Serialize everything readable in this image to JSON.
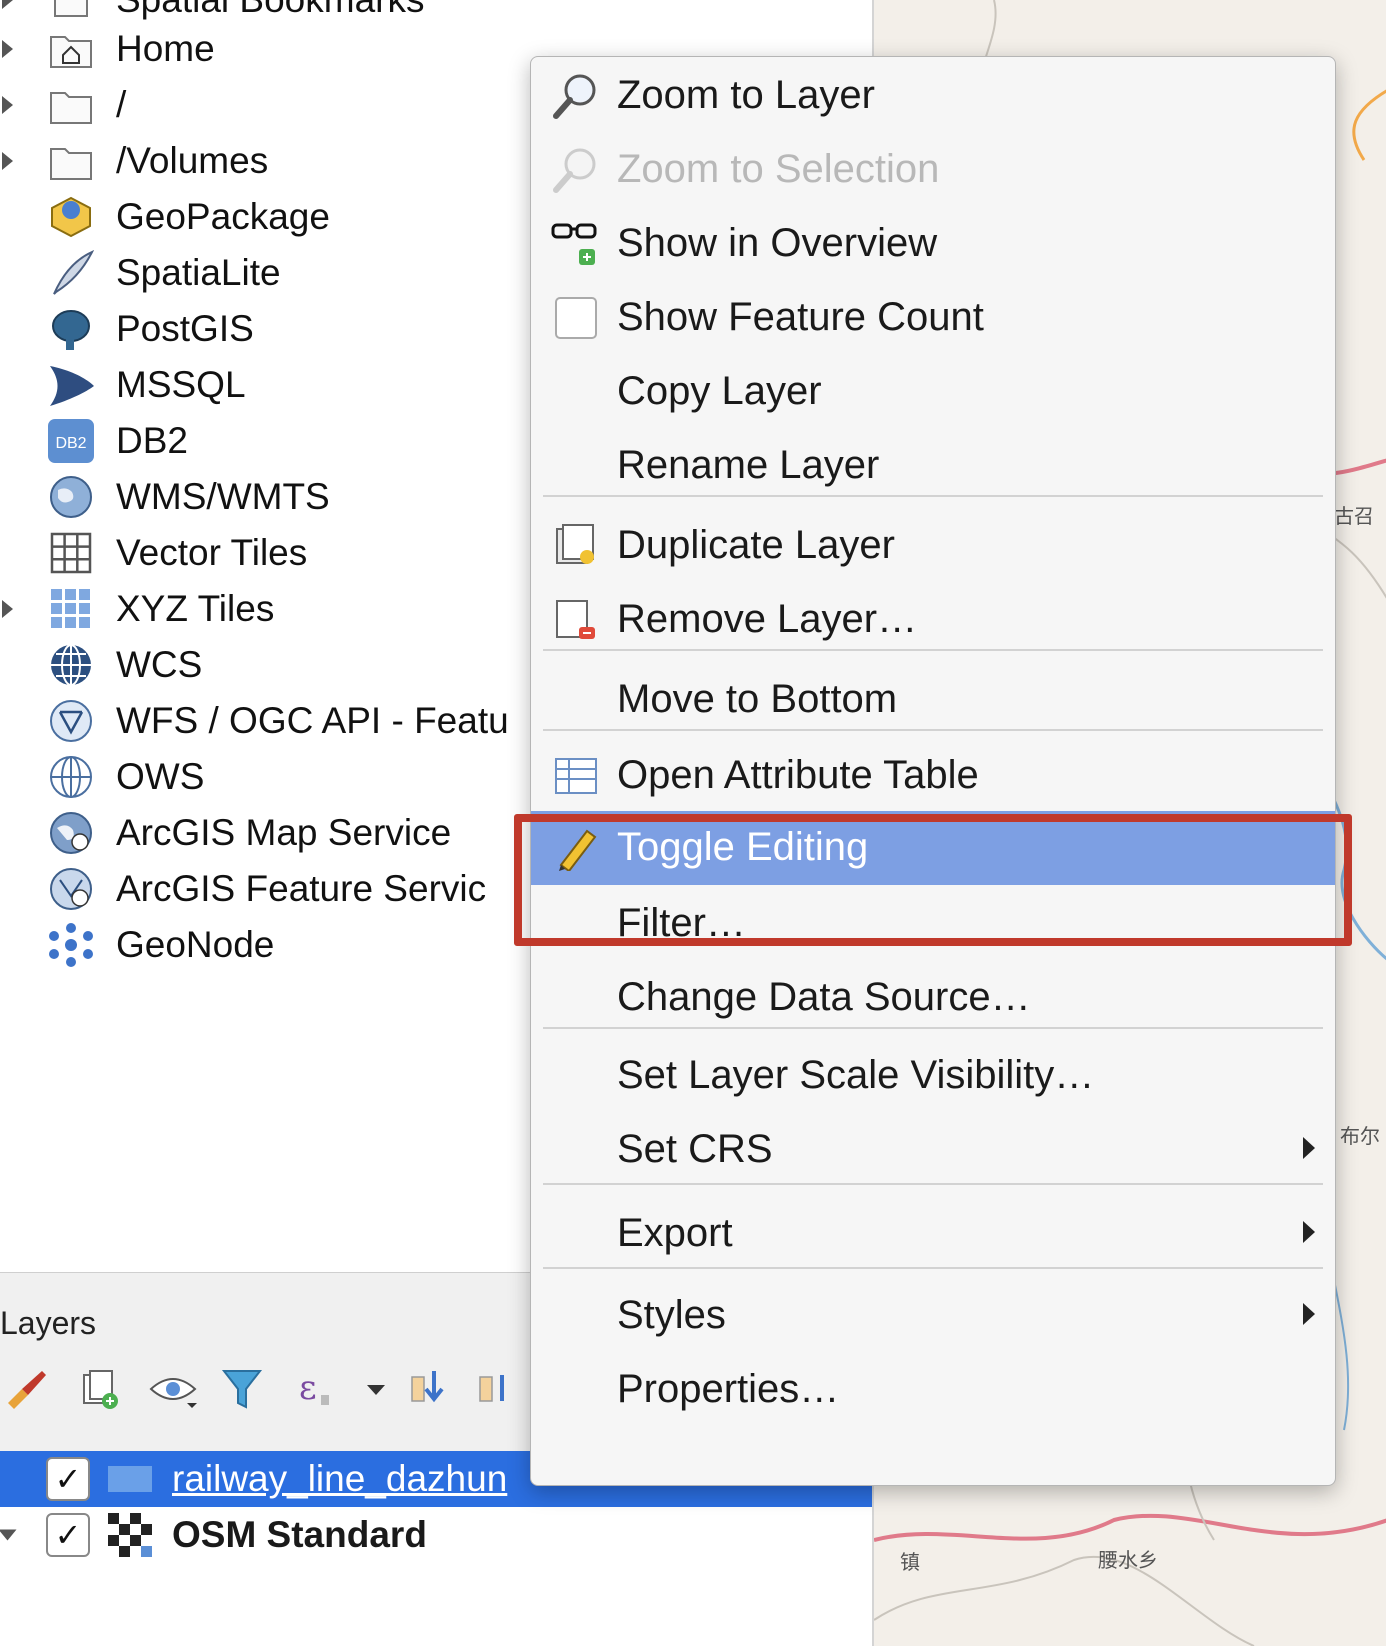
{
  "browser_items": [
    {
      "label": "Spatial Bookmarks",
      "icon": "bookmark-icon",
      "expandable": true
    },
    {
      "label": "Home",
      "icon": "home-folder-icon",
      "expandable": true
    },
    {
      "label": "/",
      "icon": "folder-icon",
      "expandable": true
    },
    {
      "label": "/Volumes",
      "icon": "folder-icon",
      "expandable": true
    },
    {
      "label": "GeoPackage",
      "icon": "geopackage-icon",
      "expandable": false
    },
    {
      "label": "SpatiaLite",
      "icon": "spatialite-feather-icon",
      "expandable": false
    },
    {
      "label": "PostGIS",
      "icon": "postgis-elephant-icon",
      "expandable": false
    },
    {
      "label": "MSSQL",
      "icon": "mssql-icon",
      "expandable": false
    },
    {
      "label": "DB2",
      "icon": "db2-icon",
      "expandable": false
    },
    {
      "label": "WMS/WMTS",
      "icon": "wms-globe-icon",
      "expandable": false
    },
    {
      "label": "Vector Tiles",
      "icon": "vector-tiles-grid-icon",
      "expandable": false
    },
    {
      "label": "XYZ Tiles",
      "icon": "xyz-tiles-icon",
      "expandable": true
    },
    {
      "label": "WCS",
      "icon": "wcs-globe-icon",
      "expandable": false
    },
    {
      "label": "WFS / OGC API - Featu",
      "icon": "wfs-globe-icon",
      "expandable": false
    },
    {
      "label": "OWS",
      "icon": "ows-globe-icon",
      "expandable": false
    },
    {
      "label": "ArcGIS Map Service",
      "icon": "arcgis-map-icon",
      "expandable": false
    },
    {
      "label": "ArcGIS Feature Servic",
      "icon": "arcgis-feature-icon",
      "expandable": false
    },
    {
      "label": "GeoNode",
      "icon": "geonode-icon",
      "expandable": false
    }
  ],
  "layers_panel": {
    "title": "Layers",
    "toolbar": [
      "style-brush-icon",
      "add-group-icon",
      "visibility-eye-icon",
      "filter-icon",
      "expression-icon",
      "expand-all-icon",
      "collapse-all-icon"
    ],
    "layers": [
      {
        "name": "railway_line_dazhun",
        "checked": true,
        "selected": true
      },
      {
        "name": "OSM Standard",
        "checked": true,
        "selected": false
      }
    ]
  },
  "context_menu": {
    "items": [
      {
        "label": "Zoom to Layer",
        "icon": "zoom-magnifier-icon"
      },
      {
        "label": "Zoom to Selection",
        "icon": "zoom-selection-icon",
        "disabled": true
      },
      {
        "label": "Show in Overview",
        "icon": "overview-glasses-icon"
      },
      {
        "label": "Show Feature Count",
        "icon": "checkbox-icon"
      },
      {
        "label": "Copy Layer"
      },
      {
        "label": "Rename Layer"
      },
      {
        "label": "Duplicate Layer",
        "icon": "duplicate-layer-icon"
      },
      {
        "label": "Remove Layer…",
        "icon": "remove-layer-icon"
      },
      {
        "label": "Move to Bottom"
      },
      {
        "label": "Open Attribute Table",
        "icon": "attribute-table-icon"
      },
      {
        "label": "Toggle Editing",
        "icon": "pencil-icon",
        "highlighted": true
      },
      {
        "label": "Filter…"
      },
      {
        "label": "Change Data Source…"
      },
      {
        "label": "Set Layer Scale Visibility…"
      },
      {
        "label": "Set CRS",
        "submenu": true
      },
      {
        "label": "Export",
        "submenu": true
      },
      {
        "label": "Styles",
        "submenu": true
      },
      {
        "label": "Properties…"
      }
    ]
  },
  "map_labels": [
    "古召",
    "布尔",
    "镇",
    "腰水乡"
  ],
  "colors": {
    "selection": "#2b6ee0",
    "menu_highlight": "#7d9fe3",
    "annotation_box": "#c0392b"
  }
}
